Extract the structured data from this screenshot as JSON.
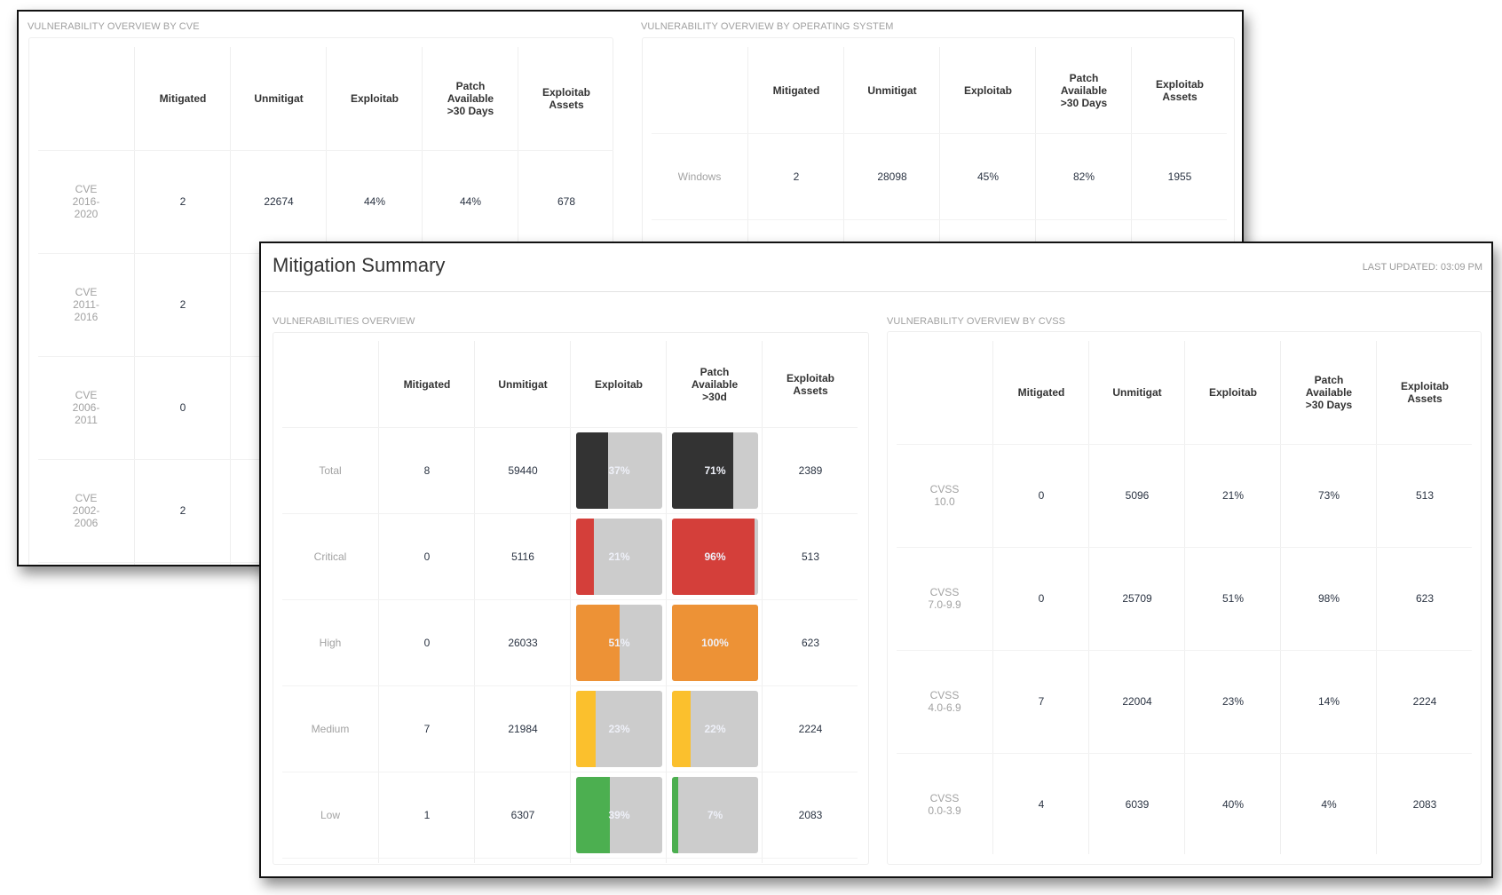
{
  "back_window": {
    "cve_section": {
      "label": "VULNERABILITY OVERVIEW BY CVE",
      "headers": [
        "",
        "Mitigated",
        "Unmitigat",
        "Exploitab",
        "Patch\nAvailable\n>30 Days",
        "Exploitab\nAssets"
      ],
      "rows": [
        {
          "label": "CVE\n2016-2020",
          "mitigated": "2",
          "unmitigated": "22674",
          "exploitable": "44%",
          "patch": "44%",
          "assets": "678"
        },
        {
          "label": "CVE\n2011-2016",
          "mitigated": "2"
        },
        {
          "label": "CVE\n2006-2011",
          "mitigated": "0"
        },
        {
          "label": "CVE\n2002-2006",
          "mitigated": "2"
        }
      ]
    },
    "os_section": {
      "label": "VULNERABILITY OVERVIEW BY OPERATING SYSTEM",
      "headers": [
        "",
        "Mitigated",
        "Unmitigat",
        "Exploitab",
        "Patch\nAvailable\n>30 Days",
        "Exploitab\nAssets"
      ],
      "rows": [
        {
          "label": "Windows",
          "mitigated": "2",
          "unmitigated": "28098",
          "exploitable": "45%",
          "patch": "82%",
          "assets": "1955"
        }
      ]
    }
  },
  "front_window": {
    "title": "Mitigation Summary",
    "last_updated": "LAST UPDATED: 03:09 PM",
    "vuln_section": {
      "label": "VULNERABILITIES OVERVIEW",
      "headers": [
        "",
        "Mitigated",
        "Unmitigat",
        "Exploitab",
        "Patch\nAvailable\n>30d",
        "Exploitab\nAssets"
      ],
      "rows": [
        {
          "label": "Total",
          "mitigated": "8",
          "unmitigated": "59440",
          "exploitable": "37%",
          "exploitable_value": 37,
          "patch": "71%",
          "patch_value": 71,
          "assets": "2389",
          "color": "#333333"
        },
        {
          "label": "Critical",
          "mitigated": "0",
          "unmitigated": "5116",
          "exploitable": "21%",
          "exploitable_value": 21,
          "patch": "96%",
          "patch_value": 96,
          "assets": "513",
          "color": "#d43f3a"
        },
        {
          "label": "High",
          "mitigated": "0",
          "unmitigated": "26033",
          "exploitable": "51%",
          "exploitable_value": 51,
          "patch": "100%",
          "patch_value": 100,
          "assets": "623",
          "color": "#ed9236"
        },
        {
          "label": "Medium",
          "mitigated": "7",
          "unmitigated": "21984",
          "exploitable": "23%",
          "exploitable_value": 23,
          "patch": "22%",
          "patch_value": 22,
          "assets": "2224",
          "color": "#fbc02d"
        },
        {
          "label": "Low",
          "mitigated": "1",
          "unmitigated": "6307",
          "exploitable": "39%",
          "exploitable_value": 39,
          "patch": "7%",
          "patch_value": 7,
          "assets": "2083",
          "color": "#4caf50"
        }
      ],
      "bar_track_color": "#cccccc"
    },
    "cvss_section": {
      "label": "VULNERABILITY OVERVIEW BY CVSS",
      "headers": [
        "",
        "Mitigated",
        "Unmitigat",
        "Exploitab",
        "Patch\nAvailable\n>30 Days",
        "Exploitab\nAssets"
      ],
      "rows": [
        {
          "label": "CVSS\n10.0",
          "mitigated": "0",
          "unmitigated": "5096",
          "exploitable": "21%",
          "patch": "73%",
          "assets": "513"
        },
        {
          "label": "CVSS\n7.0-9.9",
          "mitigated": "0",
          "unmitigated": "25709",
          "exploitable": "51%",
          "patch": "98%",
          "assets": "623"
        },
        {
          "label": "CVSS\n4.0-6.9",
          "mitigated": "7",
          "unmitigated": "22004",
          "exploitable": "23%",
          "patch": "14%",
          "assets": "2224"
        },
        {
          "label": "CVSS\n0.0-3.9",
          "mitigated": "4",
          "unmitigated": "6039",
          "exploitable": "40%",
          "patch": "4%",
          "assets": "2083"
        }
      ]
    }
  }
}
